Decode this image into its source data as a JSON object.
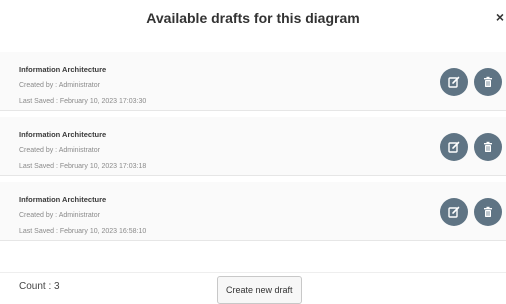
{
  "modal": {
    "title": "Available drafts for this diagram",
    "close_symbol": "×"
  },
  "drafts": [
    {
      "name": "Information Architecture",
      "created_by": "Created by : Administrator",
      "last_saved": "Last Saved : February 10, 2023 17:03:30"
    },
    {
      "name": "Information Architecture",
      "created_by": "Created by : Administrator",
      "last_saved": "Last Saved : February 10, 2023 17:03:18"
    },
    {
      "name": "Information Architecture",
      "created_by": "Created by : Administrator",
      "last_saved": "Last Saved : February 10, 2023 16:58:10"
    }
  ],
  "icons": {
    "edit": "edit-icon",
    "delete": "trash-icon"
  },
  "colors": {
    "action_button": "#5f7484"
  },
  "footer": {
    "count_label": "Count : 3",
    "create_button_label": "Create new draft"
  }
}
